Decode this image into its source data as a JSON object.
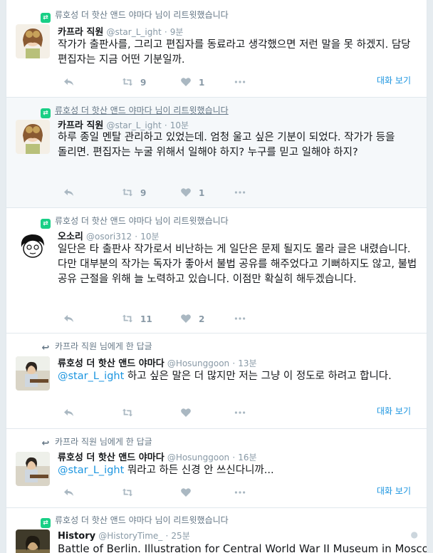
{
  "tweets": [
    {
      "context": "류호성 더 핫산 앤드 야마다 님이 리트윗했습니다",
      "name": "카프라 직원",
      "handle": "@star_L_ight",
      "time": "9분",
      "text": "작가가 출판사를, 그리고 편집자를 동료라고 생각했으면 저런 말을 못 하겠지. 담당 편집자는 지금 어떤 기분일까.",
      "retweets": "9",
      "likes": "1",
      "conversation": "대화 보기"
    },
    {
      "context": "류호성 더 핫산 앤드 야마다 님이 리트윗했습니다",
      "name": "카프라 직원",
      "handle": "@star_L_ight",
      "time": "10분",
      "text": "하루 종일 멘탈 관리하고 있었는데. 엄청 울고 싶은 기분이 되었다. 작가가 등을 돌리면. 편집자는 누굴 위해서 일해야 하지? 누구를 믿고 일해야 하지?",
      "retweets": "9",
      "likes": "1"
    },
    {
      "context": "류호성 더 핫산 앤드 야마다 님이 리트윗했습니다",
      "name": "오소리",
      "handle": "@osori312",
      "time": "10분",
      "text": "일단은 타 출판사 작가로서 비난하는 게 일단은 문제 될지도 몰라 글은 내렸습니다. 다만 대부분의 작가는 독자가 좋아서 불법 공유를 해주었다고 기뻐하지도 않고, 불법 공유 근절을 위해 늘 노력하고 있습니다. 이점만 확실히 해두겠습니다.",
      "retweets": "11",
      "likes": "2"
    },
    {
      "context": "카프라 직원 님에게 한 답글",
      "name": "류호성 더 핫산 앤드 야마다",
      "handle": "@Hosunggoon",
      "time": "13분",
      "mention": "@star_L_ight",
      "text": " 하고 싶은 말은 더 많지만 저는 그냥 이 정도로 하려고 합니다.",
      "conversation": "대화 보기"
    },
    {
      "context": "카프라 직원 님에게 한 답글",
      "name": "류호성 더 핫산 앤드 야마다",
      "handle": "@Hosunggoon",
      "time": "16분",
      "mention": "@star_L_ight",
      "text": " 뭐라고 하든 신경 안 쓰신다니까...",
      "conversation": "대화 보기"
    },
    {
      "context": "류호성 더 핫산 앤드 야마다 님이 리트윗했습니다",
      "name": "History",
      "handle": "@HistoryTime_",
      "time": "25분",
      "text": "Battle of Berlin. Illustration for Central World War II Museum in Moscow"
    }
  ],
  "icons": {
    "retweet_context": "retweet-icon",
    "reply_context": "reply-icon",
    "reply": "reply-arrow-icon",
    "retweet": "retweet-icon",
    "like": "heart-icon",
    "more": "more-dots-icon"
  },
  "colors": {
    "link": "#1b95e0",
    "retweet_green": "#19cf86",
    "muted": "#8899a6",
    "highlight_bg": "#f5f8fa"
  }
}
